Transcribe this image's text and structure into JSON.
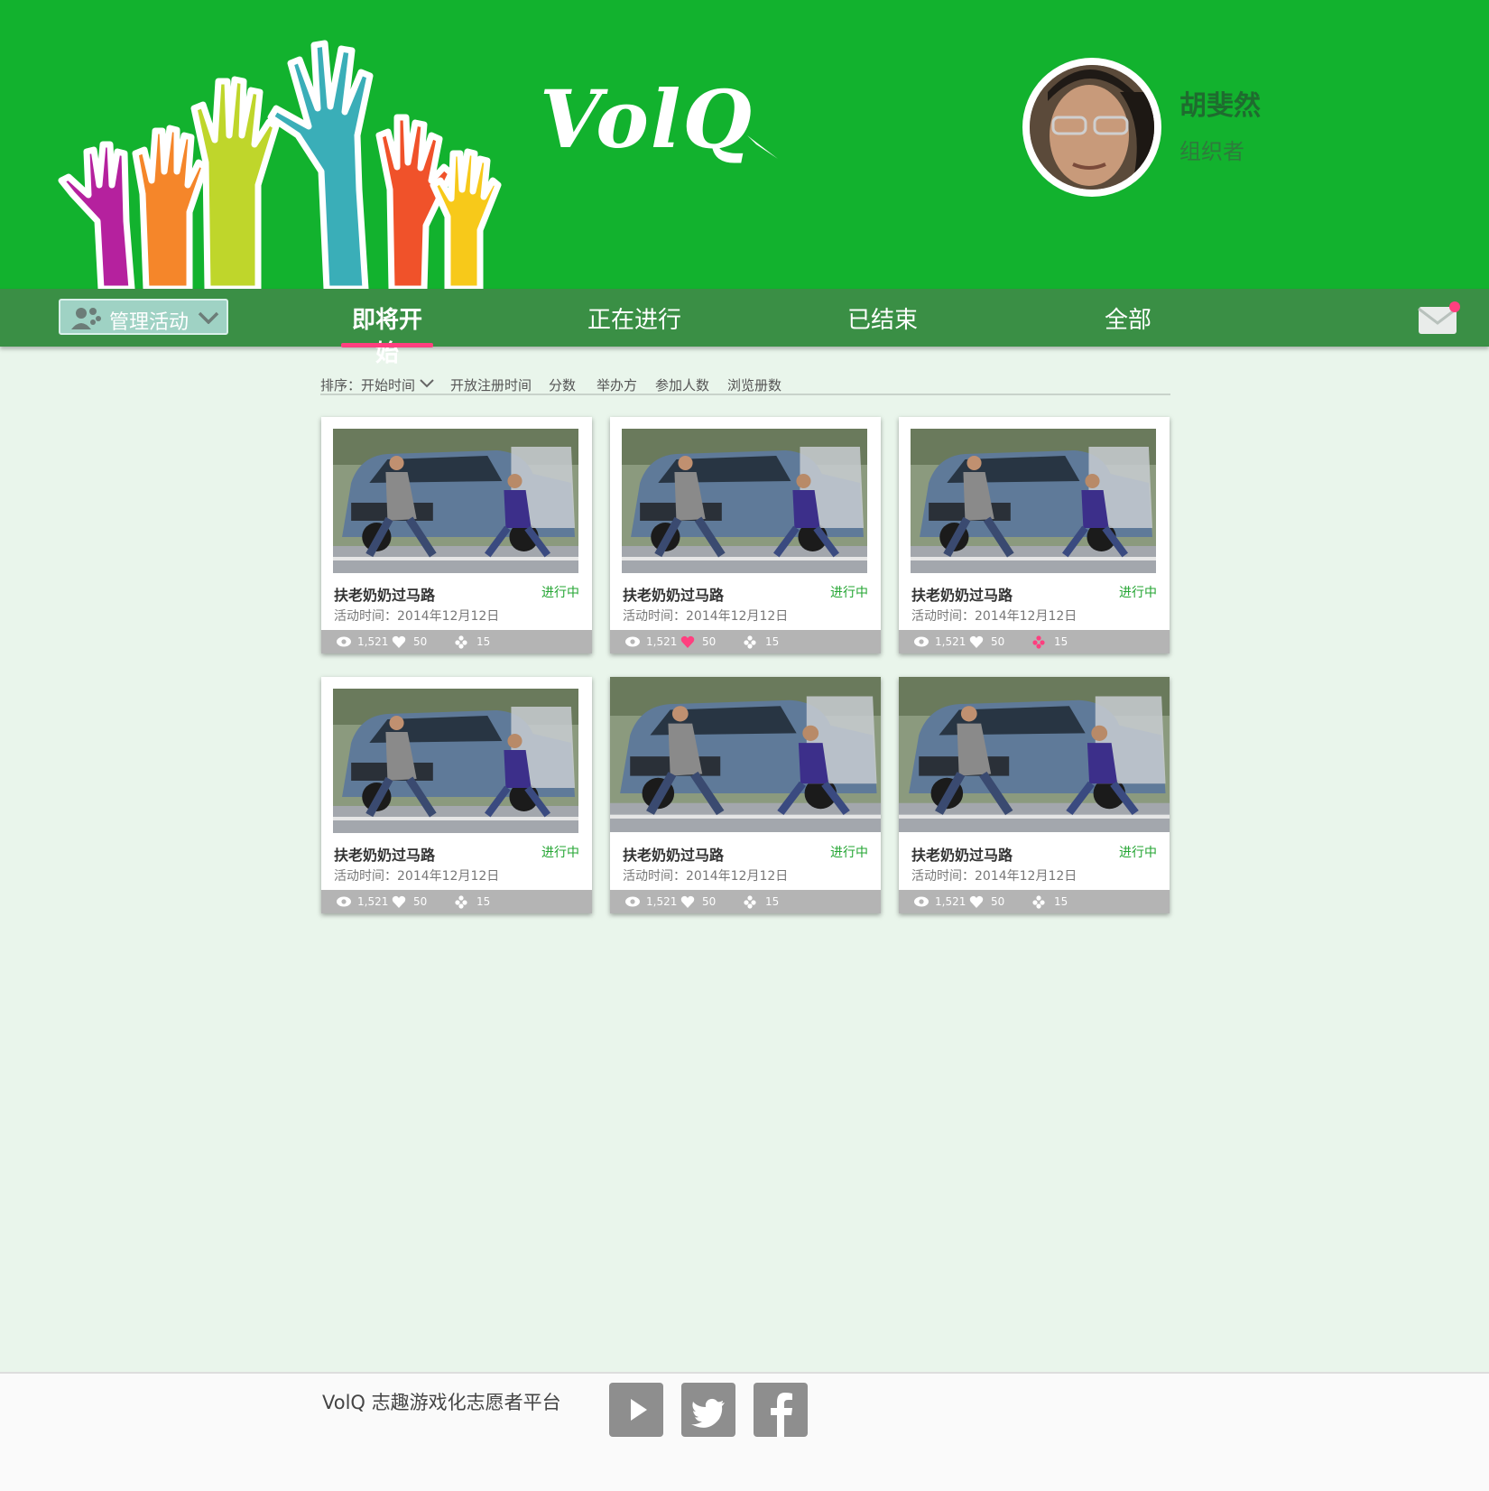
{
  "app": {
    "logo": "VolQ"
  },
  "user": {
    "name": "胡斐然",
    "role": "组织者"
  },
  "nav": {
    "manage_label": "管理活动",
    "tabs": [
      {
        "label": "即将开始",
        "active": true
      },
      {
        "label": "正在进行",
        "active": false
      },
      {
        "label": "已结束",
        "active": false
      },
      {
        "label": "全部",
        "active": false
      }
    ],
    "mail_has_unread": true
  },
  "sort": {
    "prefix": "排序：",
    "options": [
      "开始时间",
      "开放注册时间",
      "分数",
      "举办方",
      "参加人数",
      "浏览册数"
    ]
  },
  "cards": [
    {
      "title": "扶老奶奶过马路",
      "status": "进行中",
      "time": "活动时间：2014年12月12日",
      "views": "1,521",
      "likes": "50",
      "shares": "15",
      "liked": false,
      "shared": false
    },
    {
      "title": "扶老奶奶过马路",
      "status": "进行中",
      "time": "活动时间：2014年12月12日",
      "views": "1,521",
      "likes": "50",
      "shares": "15",
      "liked": true,
      "shared": false
    },
    {
      "title": "扶老奶奶过马路",
      "status": "进行中",
      "time": "活动时间：2014年12月12日",
      "views": "1,521",
      "likes": "50",
      "shares": "15",
      "liked": false,
      "shared": true
    },
    {
      "title": "扶老奶奶过马路",
      "status": "进行中",
      "time": "活动时间：2014年12月12日",
      "views": "1,521",
      "likes": "50",
      "shares": "15",
      "liked": false,
      "shared": false
    },
    {
      "title": "扶老奶奶过马路",
      "status": "进行中",
      "time": "活动时间：2014年12月12日",
      "views": "1,521",
      "likes": "50",
      "shares": "15",
      "liked": false,
      "shared": false
    },
    {
      "title": "扶老奶奶过马路",
      "status": "进行中",
      "time": "活动时间：2014年12月12日",
      "views": "1,521",
      "likes": "50",
      "shares": "15",
      "liked": false,
      "shared": false
    }
  ],
  "footer": {
    "text": "VolQ 志趣游戏化志愿者平台",
    "social": [
      "youtube-icon",
      "twitter-icon",
      "facebook-icon"
    ]
  },
  "colors": {
    "header_green": "#12b22e",
    "nav_green": "#3a8f45",
    "accent_pink": "#ff3f7f",
    "status_green": "#23a532",
    "stats_gray": "#b4b4b4"
  }
}
